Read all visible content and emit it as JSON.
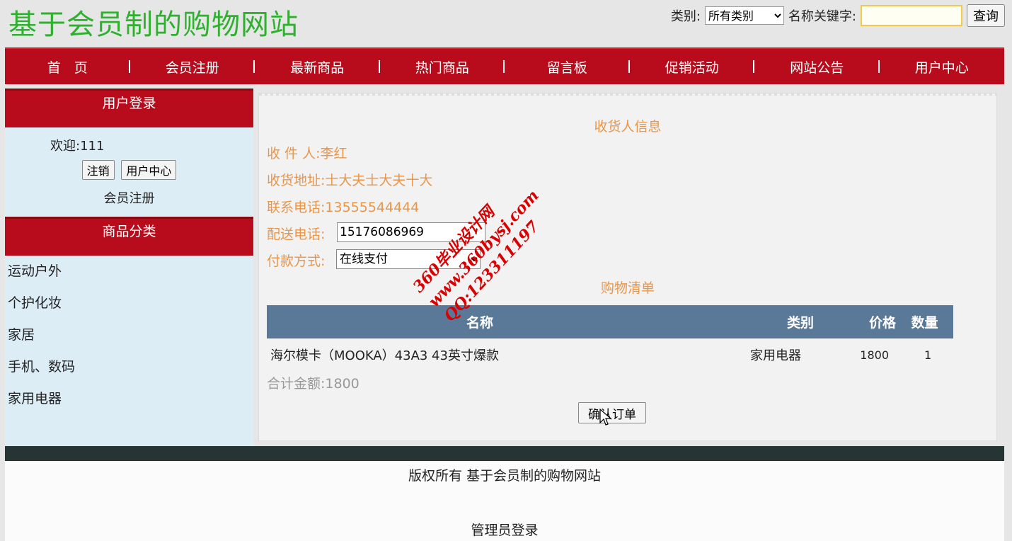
{
  "header": {
    "site_title": "基于会员制的购物网站",
    "category_label": "类别:",
    "category_selected": "所有类别",
    "keyword_label": "名称关键字:",
    "search_button": "查询"
  },
  "nav": [
    "首　页",
    "会员注册",
    "最新商品",
    "热门商品",
    "留言板",
    "促销活动",
    "网站公告",
    "用户中心"
  ],
  "sidebar": {
    "login_title": "用户登录",
    "welcome_label": "欢迎:",
    "username": "111",
    "logout_button": "注销",
    "user_center_button": "用户中心",
    "register_link": "会员注册",
    "category_title": "商品分类",
    "categories": [
      "运动户外",
      "个护化妆",
      "家居",
      "手机、数码",
      "家用电器"
    ]
  },
  "order": {
    "receiver_section_title": "收货人信息",
    "receiver_label": "收 件 人:",
    "receiver_value": "李红",
    "address_label": "收货地址:",
    "address_value": "士大夫士大夫十大",
    "contact_phone_label": "联系电话:",
    "contact_phone_value": "13555544444",
    "delivery_phone_label": "配送电话:",
    "delivery_phone_value": "15176086969",
    "payment_label": "付款方式:",
    "payment_selected": "在线支付",
    "cart_section_title": "购物清单",
    "columns": [
      "名称",
      "类别",
      "价格",
      "数量"
    ],
    "rows": [
      {
        "name": "海尔模卡（MOOKA）43A3 43英寸爆款",
        "category": "家用电器",
        "price": "1800",
        "quantity": "1"
      }
    ],
    "total_label": "合计金额:",
    "total_value": "1800",
    "confirm_button": "确认订单"
  },
  "watermark": {
    "line1": "360毕业设计网",
    "line2": "www.360bysj.com",
    "line3": "QQ:123311197"
  },
  "footer": {
    "copyright": "版权所有  基于会员制的购物网站",
    "admin_login": "管理员登录"
  },
  "colors": {
    "title_green": "#2fb12f",
    "nav_red": "#b80c1c",
    "accent_orange": "#e8964a",
    "table_header": "#5a7898",
    "sidebar_bg": "#dcedf6"
  }
}
